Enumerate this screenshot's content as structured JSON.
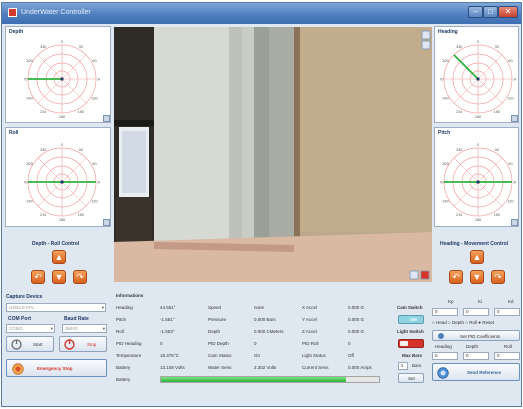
{
  "window": {
    "title": "UnderWater Controller"
  },
  "panels": {
    "depth": {
      "title": "Depth"
    },
    "roll": {
      "title": "Roll"
    },
    "heading": {
      "title": "Heading"
    },
    "pitch": {
      "title": "Pitch"
    }
  },
  "compass_labels": [
    "0",
    "30",
    "60",
    "90",
    "120",
    "150",
    "180",
    "210",
    "240",
    "270",
    "300",
    "330"
  ],
  "controls": {
    "depth_roll_title": "Depth - Roll Control",
    "heading_movement_title": "Heading - Movement Control"
  },
  "capture": {
    "title": "Capture Device",
    "device_value": "USB2.0 ATV",
    "com_port_label": "COM Port",
    "baud_rate_label": "Baud Rate",
    "com_port_value": "COM3",
    "baud_rate_value": "38400",
    "start_label": "Start",
    "stop_label": "Stop",
    "emergency_label": "Emergency Stop"
  },
  "informations": {
    "title": "Informations",
    "rows": [
      [
        {
          "label": "Heading",
          "value": "44.551°"
        },
        {
          "label": "Speed",
          "value": "none"
        },
        {
          "label": "X Accel",
          "value": "0.000 G"
        }
      ],
      [
        {
          "label": "Pitch",
          "value": "-1.551°"
        },
        {
          "label": "Pressure",
          "value": "0.000 Bars"
        },
        {
          "label": "Y Accel",
          "value": "0.000 G"
        }
      ],
      [
        {
          "label": "Roll",
          "value": "-1.553°"
        },
        {
          "label": "Depth",
          "value": "0.000 CMeters"
        },
        {
          "label": "Z Accel",
          "value": "0.000 G"
        }
      ],
      [
        {
          "label": "PID Heading",
          "value": "0"
        },
        {
          "label": "PID Depth",
          "value": "0"
        },
        {
          "label": "PID Roll",
          "value": "0"
        }
      ],
      [
        {
          "label": "Temperature",
          "value": "18.375°C"
        },
        {
          "label": "Cam Status",
          "value": "On"
        },
        {
          "label": "Light Status",
          "value": "Off"
        }
      ],
      [
        {
          "label": "Battery",
          "value": "13.108 Volts"
        },
        {
          "label": "Water Sens",
          "value": "2.302 Volts"
        },
        {
          "label": "Current Sens",
          "value": "0.000 Amps"
        }
      ]
    ],
    "battery_label": "Battery",
    "battery_level": 0.85
  },
  "switches": {
    "cam_switch_label": "Cam Switch",
    "cam_state": "ON",
    "light_switch_label": "Light Switch",
    "max_bars_label": "Max Bars",
    "max_bars_value": "2",
    "max_bars_unit": "Bars",
    "set_label": "Set"
  },
  "pid": {
    "kp_label": "Kp",
    "ki_label": "Ki",
    "kd_label": "Kd",
    "kp_value": "0",
    "ki_value": "0",
    "kd_value": "0",
    "radio_heading": "Head",
    "radio_depth": "Depth",
    "radio_roll": "Roll",
    "reset_label": "Reset",
    "set_coefficients_label": "Set PID Coefficients",
    "heading_label": "Heading",
    "depth_label": "Depth",
    "roll_label": "Roll",
    "heading_value": "0",
    "depth_value": "0",
    "roll_value": "0",
    "send_reference_label": "Send Reference"
  },
  "colors": {
    "accent": "#4f7fbf",
    "orange": "#e0702a",
    "green": "#3cc24a",
    "red": "#d6332a"
  }
}
